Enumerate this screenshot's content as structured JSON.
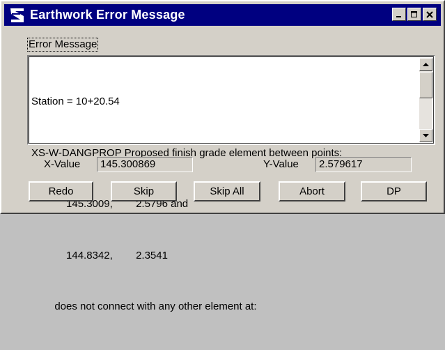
{
  "window": {
    "title": "Earthwork Error Message",
    "icons": {
      "app": "earthwork-app-icon",
      "minimize": "minimize-icon",
      "maximize": "maximize-icon",
      "close": "close-icon"
    }
  },
  "group": {
    "label": "Error Message"
  },
  "message": {
    "lines": [
      "Station = 10+20.54",
      "XS-W-DANGPROP Proposed finish grade element between points:",
      "            145.3009,        2.5796 and",
      "            144.8342,        2.3541",
      "        does not connect with any other element at:"
    ]
  },
  "fields": {
    "x_label": "X-Value",
    "x_value": "145.300869",
    "y_label": "Y-Value",
    "y_value": "2.579617"
  },
  "buttons": {
    "redo": "Redo",
    "skip": "Skip",
    "skip_all": "Skip All",
    "abort": "Abort",
    "dp": "DP"
  }
}
